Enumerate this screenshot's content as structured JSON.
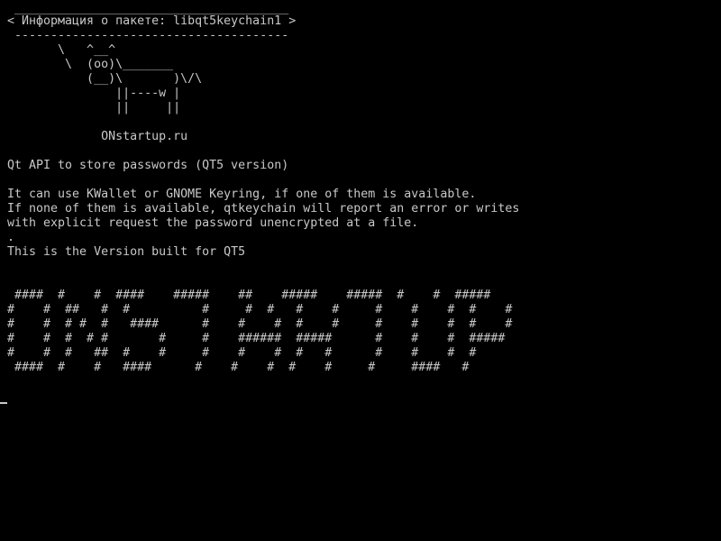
{
  "header": {
    "rule_top": " ______________________________________",
    "title": "< Информация о пакете: libqt5keychain1 >",
    "rule_bottom": " --------------------------------------"
  },
  "cow_art": [
    "       \\   ^__^",
    "        \\  (oo)\\_______",
    "           (__)\\       )\\/\\",
    "               ||----w |",
    "               ||     ||"
  ],
  "site_credit": "             ONstartup.ru",
  "description": {
    "summary": "Qt API to store passwords (QT5 version)",
    "body": [
      "It can use KWallet or GNOME Keyring, if one of them is available.",
      "If none of them is available, qtkeychain will report an error or writes",
      "with explicit request the password unencrypted at a file.",
      ".",
      "This is the Version built for QT5"
    ]
  },
  "banner": [
    " ####  #    #  ####    #####    ##    #####    #####  #    #  #####",
    "#    #  ##   #  #          #     #  #   #    #     #    #    #  #    #",
    "#    #  # #  #   ####      #    #    #  #    #     #    #    #  #    #",
    "#    #  #  # #       #     #    ######  #####      #    #    #  #####",
    "#    #  #   ##  #    #     #    #    #  #   #      #    #    #  #",
    " ####  #    #   ####      #    #    #  #    #     #     ####   #"
  ]
}
